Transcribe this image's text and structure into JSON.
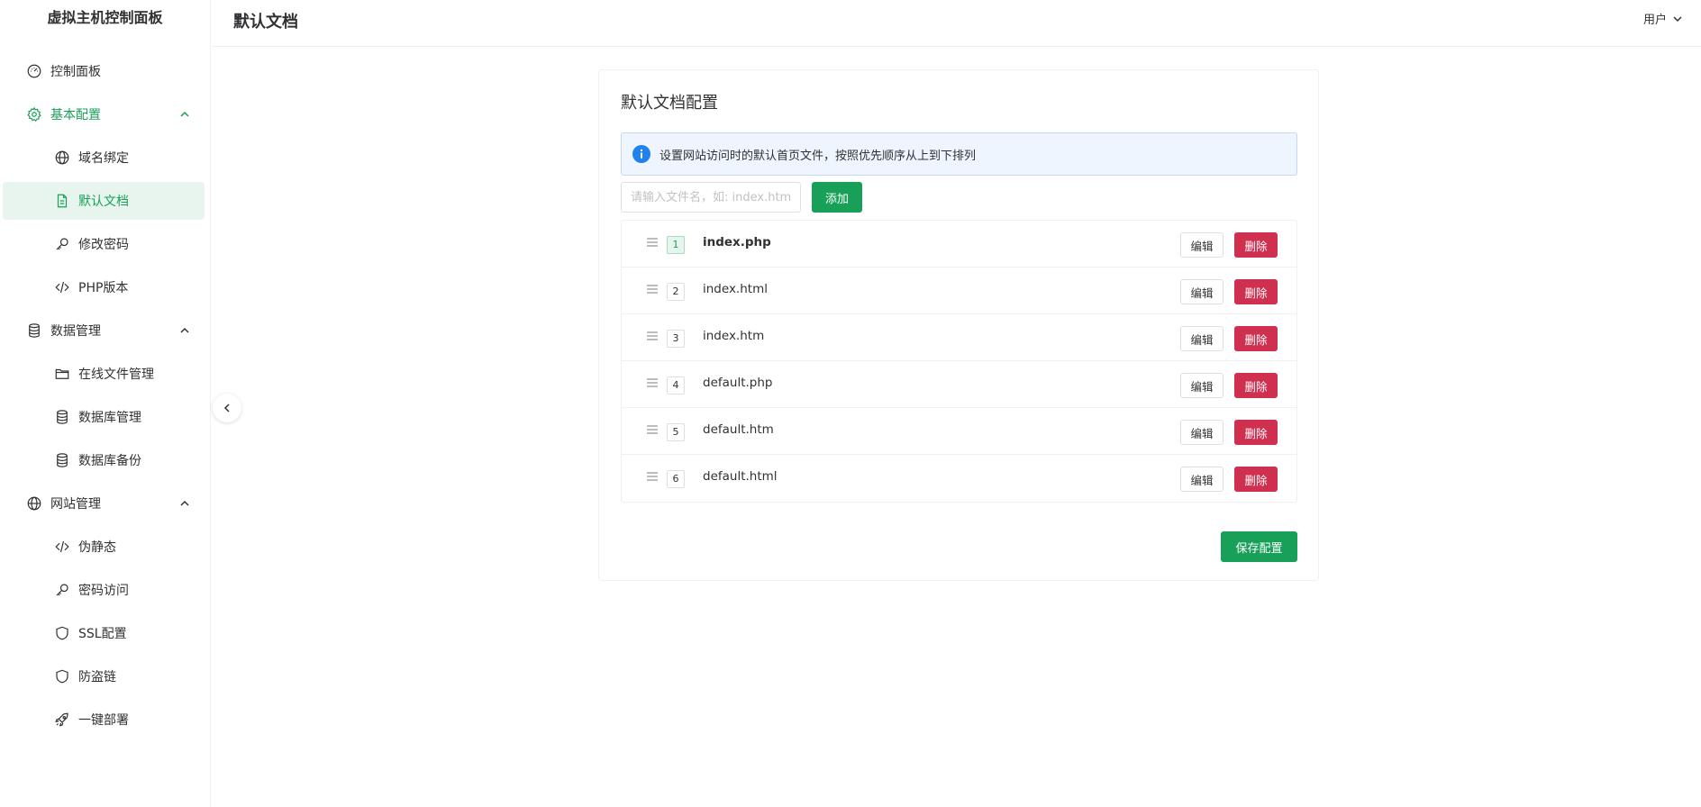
{
  "brand": "虚拟主机控制面板",
  "sidebar": {
    "items": [
      {
        "label": "控制面板",
        "icon": "dashboard-icon"
      },
      {
        "label": "基本配置",
        "icon": "gear-icon"
      },
      {
        "label": "域名绑定",
        "icon": "globe-icon"
      },
      {
        "label": "默认文档",
        "icon": "document-icon"
      },
      {
        "label": "修改密码",
        "icon": "key-icon"
      },
      {
        "label": "PHP版本",
        "icon": "code-icon"
      },
      {
        "label": "数据管理",
        "icon": "database-icon"
      },
      {
        "label": "在线文件管理",
        "icon": "folder-icon"
      },
      {
        "label": "数据库管理",
        "icon": "database-icon"
      },
      {
        "label": "数据库备份",
        "icon": "database-icon"
      },
      {
        "label": "网站管理",
        "icon": "globe-icon"
      },
      {
        "label": "伪静态",
        "icon": "code-icon"
      },
      {
        "label": "密码访问",
        "icon": "key-icon"
      },
      {
        "label": "SSL配置",
        "icon": "shield-icon"
      },
      {
        "label": "防盗链",
        "icon": "shield-icon"
      },
      {
        "label": "一键部署",
        "icon": "rocket-icon"
      }
    ]
  },
  "header": {
    "title": "默认文档",
    "user": "用户"
  },
  "card": {
    "title": "默认文档配置",
    "alert": "设置网站访问时的默认首页文件，按照优先顺序从上到下排列",
    "input_placeholder": "请输入文件名，如: index.htm",
    "add_label": "添加",
    "files": [
      {
        "index": "1",
        "name": "index.php"
      },
      {
        "index": "2",
        "name": "index.html"
      },
      {
        "index": "3",
        "name": "index.htm"
      },
      {
        "index": "4",
        "name": "default.php"
      },
      {
        "index": "5",
        "name": "default.htm"
      },
      {
        "index": "6",
        "name": "default.html"
      }
    ],
    "edit_label": "编辑",
    "delete_label": "删除",
    "save_label": "保存配置"
  },
  "colors": {
    "primary": "#18a058",
    "danger": "#d03050",
    "info": "#2080f0"
  }
}
